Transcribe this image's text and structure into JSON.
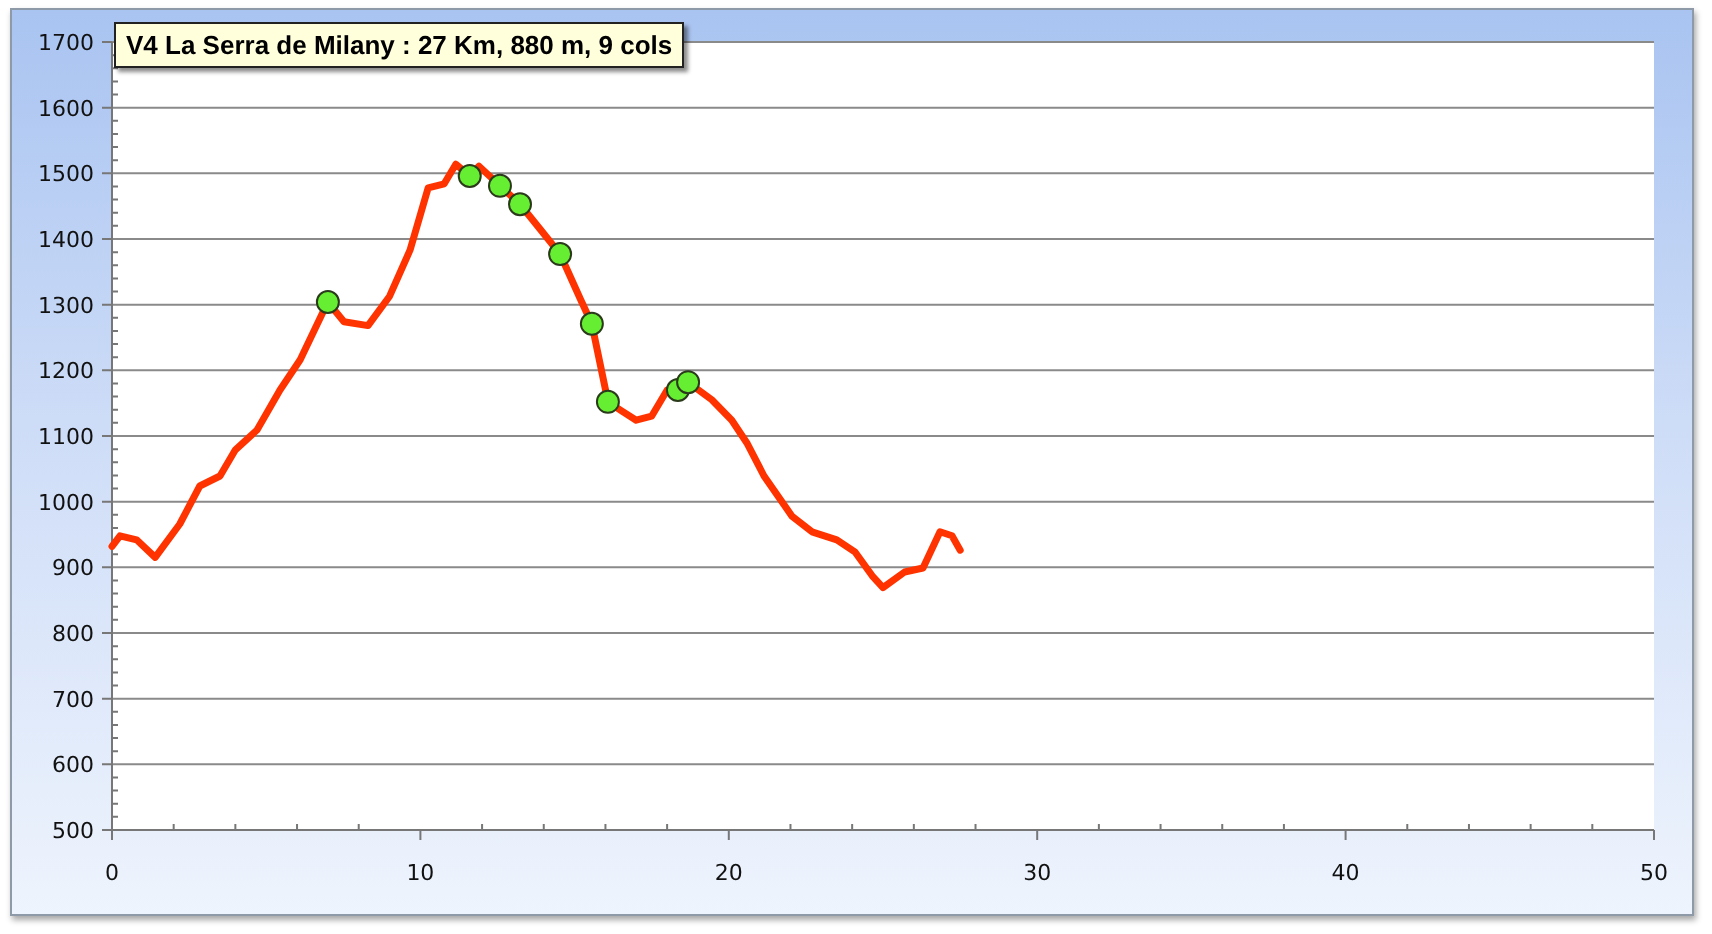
{
  "chart": {
    "chart_data": {
      "type": "line",
      "title": "V4 La Serra de Milany : 27 Km, 880 m, 9 cols",
      "grid": true,
      "xlim": [
        0,
        50
      ],
      "ylim": [
        500,
        1700
      ],
      "xticks": [
        0,
        10,
        20,
        30,
        40,
        50
      ],
      "yticks": [
        500,
        600,
        700,
        800,
        900,
        1000,
        1100,
        1200,
        1300,
        1400,
        1500,
        1600,
        1700
      ],
      "series": [
        {
          "color": "#ff3300",
          "x": [
            0,
            0.26,
            0.8,
            1.4,
            2.2,
            2.85,
            3.5,
            4.0,
            4.7,
            5.45,
            6.1,
            7.0,
            7.52,
            8.3,
            9.0,
            9.66,
            10.25,
            10.77,
            11.15,
            11.6,
            11.9,
            12.58,
            13.23,
            13.9,
            14.53,
            15.2,
            15.56,
            16.08,
            16.47,
            17.0,
            17.5,
            18.0,
            18.68,
            19.45,
            20.1,
            20.6,
            21.14,
            22.05,
            22.7,
            23.5,
            24.1,
            24.65,
            25.0,
            25.7,
            26.3,
            26.85,
            27.24,
            27.5
          ],
          "values": [
            932,
            948,
            942,
            915,
            966,
            1024,
            1039,
            1079,
            1109,
            1170,
            1216,
            1304,
            1274,
            1268,
            1313,
            1383,
            1478,
            1484,
            1514,
            1496,
            1511,
            1481,
            1453,
            1414,
            1377,
            1307,
            1271,
            1152,
            1140,
            1124,
            1130,
            1170,
            1182,
            1155,
            1124,
            1088,
            1039,
            978,
            954,
            942,
            923,
            887,
            869,
            893,
            899,
            954,
            948,
            926
          ]
        },
        {
          "type": "scatter",
          "color": "#66ee33",
          "x": [
            7.0,
            11.6,
            12.58,
            13.23,
            14.53,
            15.56,
            16.08,
            18.35,
            18.68
          ],
          "values": [
            1304,
            1496,
            1481,
            1453,
            1377,
            1271,
            1152,
            1170,
            1182
          ]
        }
      ]
    }
  }
}
